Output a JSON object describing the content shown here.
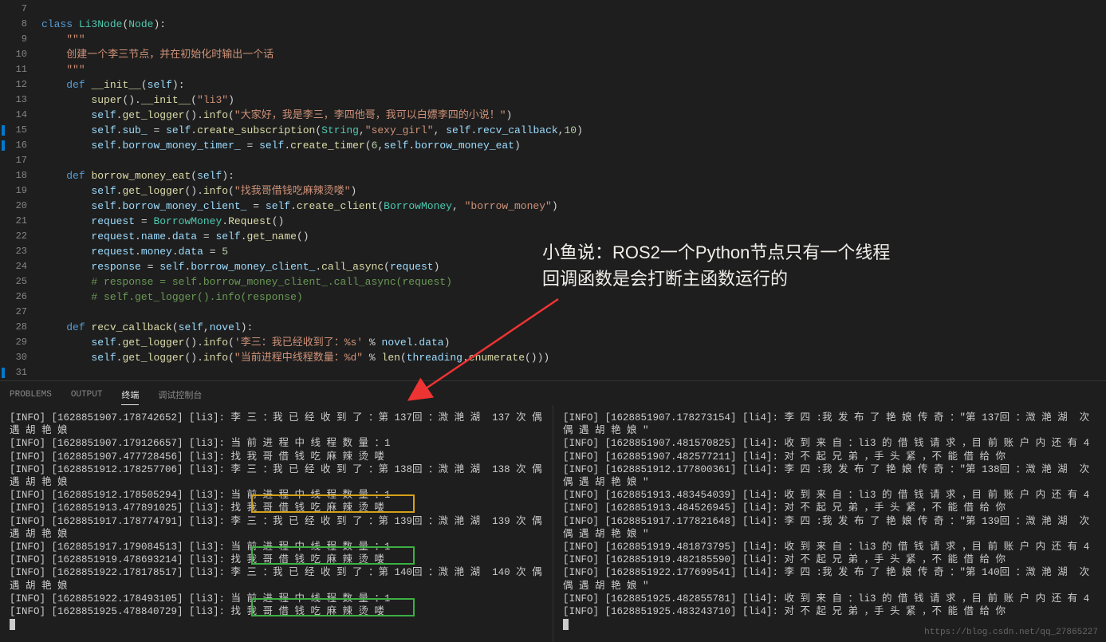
{
  "gutter": {
    "lines": [
      "7",
      "8",
      "9",
      "10",
      "11",
      "12",
      "13",
      "14",
      "15",
      "16",
      "17",
      "18",
      "19",
      "20",
      "21",
      "22",
      "23",
      "24",
      "25",
      "26",
      "27",
      "28",
      "29",
      "30",
      "31"
    ],
    "marks": [
      8,
      9,
      24
    ]
  },
  "panel": {
    "tabs": [
      "PROBLEMS",
      "OUTPUT",
      "终端",
      "调试控制台"
    ],
    "active": "终端"
  },
  "code": {
    "l7": "",
    "l8_class": "class",
    "l8_name": "Li3Node",
    "l8_paren": "(",
    "l8_base": "Node",
    "l8_end": "):",
    "l9": "    \"\"\"",
    "l10": "    创建一个李三节点，并在初始化时输出一个话",
    "l11": "    \"\"\"",
    "l12_def": "    def",
    "l12_fn": " __init__",
    "l12_args": "(self):",
    "l13": "        super().__init__(\"li3\")",
    "l14": "        self.get_logger().info(\"大家好，我是李三，李四他哥，我可以白嫖李四的小说！\")",
    "l15": "        self.sub_ = self.create_subscription(String,\"sexy_girl\", self.recv_callback,10)",
    "l16": "        self.borrow_money_timer_ = self.create_timer(6,self.borrow_money_eat)",
    "l17": "",
    "l18_def": "    def",
    "l18_fn": " borrow_money_eat",
    "l18_args": "(self):",
    "l19": "        self.get_logger().info(\"找我哥借钱吃麻辣烫喽\")",
    "l20": "        self.borrow_money_client_ = self.create_client(BorrowMoney, \"borrow_money\")",
    "l21": "        request = BorrowMoney.Request()",
    "l22": "        request.name.data = self.get_name()",
    "l23": "        request.money.data = 5",
    "l24": "        response = self.borrow_money_client_.call_async(request)",
    "l25": "        # response = self.borrow_money_client_.call_async(request)",
    "l26": "        # self.get_logger().info(response)",
    "l27": "",
    "l28_def": "    def",
    "l28_fn": " recv_callback",
    "l28_args": "(self,novel):",
    "l29": "        self.get_logger().info('李三：我已经收到了：%s' % novel.data)",
    "l30": "        self.get_logger().info(\"当前进程中线程数量：%d\" % len(threading.enumerate()))",
    "l31": ""
  },
  "annotation": {
    "line1": "小鱼说：ROS2一个Python节点只有一个线程",
    "line2": "回调函数是会打断主函数运行的"
  },
  "terminal_left": [
    "[INFO] [1628851907.178742652] [li3]: 李 三 ：我 已 经 收 到 了 ：第 137回 ：溦 滟 湖  137 次 偶 遇 胡 艳 娘",
    "[INFO] [1628851907.179126657] [li3]: 当 前 进 程 中 线 程 数 量 ：1",
    "[INFO] [1628851907.477728456] [li3]: 找 我 哥 借 钱 吃 麻 辣 烫 喽",
    "[INFO] [1628851912.178257706] [li3]: 李 三 ：我 已 经 收 到 了 ：第 138回 ：溦 滟 湖  138 次 偶 遇 胡 艳 娘",
    "[INFO] [1628851912.178505294] [li3]: 当 前 进 程 中 线 程 数 量 ：1",
    "[INFO] [1628851913.477891025] [li3]: 找 我 哥 借 钱 吃 麻 辣 烫 喽",
    "[INFO] [1628851917.178774791] [li3]: 李 三 ：我 已 经 收 到 了 ：第 139回 ：溦 滟 湖  139 次 偶 遇 胡 艳 娘",
    "[INFO] [1628851917.179084513] [li3]: 当 前 进 程 中 线 程 数 量 ：1",
    "[INFO] [1628851919.478693214] [li3]: 找 我 哥 借 钱 吃 麻 辣 烫 喽",
    "[INFO] [1628851922.178178517] [li3]: 李 三 ：我 已 经 收 到 了 ：第 140回 ：溦 滟 湖  140 次 偶 遇 胡 艳 娘",
    "[INFO] [1628851922.178493105] [li3]: 当 前 进 程 中 线 程 数 量 ：1",
    "[INFO] [1628851925.478840729] [li3]: 找 我 哥 借 钱 吃 麻 辣 烫 喽"
  ],
  "terminal_right": [
    "[INFO] [1628851907.178273154] [li4]: 李 四 :我 发 布 了 艳 娘 传 奇 ：\"第 137回 ：溦 滟 湖  次 偶 遇 胡 艳 娘 \"",
    "[INFO] [1628851907.481570825] [li4]: 收 到 来 自 ：li3 的 借 钱 请 求 ，目 前 账 户 内 还 有 4",
    "[INFO] [1628851907.482577211] [li4]: 对 不 起 兄 弟 ，手 头 紧 ，不 能 借 给 你",
    "[INFO] [1628851912.177800361] [li4]: 李 四 :我 发 布 了 艳 娘 传 奇 ：\"第 138回 ：溦 滟 湖  次 偶 遇 胡 艳 娘 \"",
    "[INFO] [1628851913.483454039] [li4]: 收 到 来 自 ：li3 的 借 钱 请 求 ，目 前 账 户 内 还 有 4",
    "[INFO] [1628851913.484526945] [li4]: 对 不 起 兄 弟 ，手 头 紧 ，不 能 借 给 你",
    "[INFO] [1628851917.177821648] [li4]: 李 四 :我 发 布 了 艳 娘 传 奇 ：\"第 139回 ：溦 滟 湖  次 偶 遇 胡 艳 娘 \"",
    "[INFO] [1628851919.481873795] [li4]: 收 到 来 自 ：li3 的 借 钱 请 求 ，目 前 账 户 内 还 有 4",
    "[INFO] [1628851919.482185590] [li4]: 对 不 起 兄 弟 ，手 头 紧 ，不 能 借 给 你",
    "[INFO] [1628851922.177699541] [li4]: 李 四 :我 发 布 了 艳 娘 传 奇 ：\"第 140回 ：溦 滟 湖  次 偶 遇 胡 艳 娘 \"",
    "[INFO] [1628851925.482855781] [li4]: 收 到 来 自 ：li3 的 借 钱 请 求 ，目 前 账 户 内 还 有 4",
    "[INFO] [1628851925.483243710] [li4]: 对 不 起 兄 弟 ，手 头 紧 ，不 能 借 给 你"
  ],
  "watermark": "https://blog.csdn.net/qq_27865227"
}
